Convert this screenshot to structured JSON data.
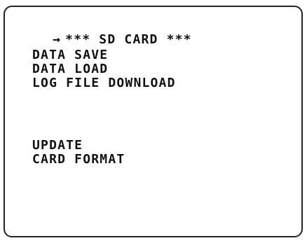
{
  "screen": {
    "cursor": "→",
    "title": "*** SD CARD ***",
    "items": [
      {
        "label": "DATA SAVE"
      },
      {
        "label": "DATA LOAD"
      },
      {
        "label": "LOG FILE DOWNLOAD"
      },
      {
        "label": "UPDATE"
      },
      {
        "label": "CARD FORMAT"
      }
    ]
  },
  "colors": {
    "text": "#111111",
    "border": "#222222",
    "background": "#ffffff"
  },
  "icons": {
    "cursor": "right-arrow-icon"
  }
}
